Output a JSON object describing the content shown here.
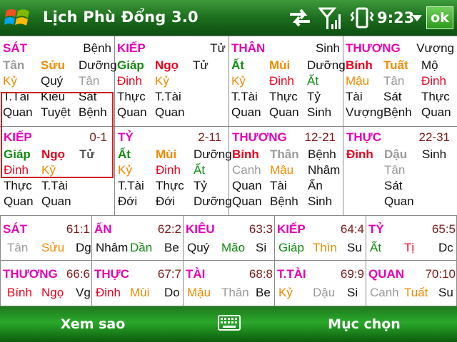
{
  "title_bar": {
    "app_title": "Lịch Phù Đổng 3.0",
    "clock": "9:23",
    "ok_label": "ok"
  },
  "top_blocks": [
    {
      "head": "SÁT",
      "head_color": "mag",
      "right": "Bệnh",
      "rows": [
        [
          [
            "Tân",
            "gry"
          ],
          [
            "Sửu",
            "org"
          ],
          [
            "Dưỡng",
            "blk"
          ]
        ],
        [
          [
            "Kỷ",
            "org"
          ],
          [
            "Quý",
            "blk"
          ],
          [
            "Tân",
            "gry"
          ]
        ],
        [
          [
            "T.Tài",
            "blk"
          ],
          [
            "Kiêu",
            "blk"
          ],
          [
            "Sát",
            "blk"
          ]
        ],
        [
          [
            "Quan",
            "blk"
          ],
          [
            "Tuyệt",
            "blk"
          ],
          [
            "Bệnh",
            "blk"
          ]
        ]
      ]
    },
    {
      "head": "KIẾP",
      "head_color": "mag",
      "right": "Tử",
      "rows": [
        [
          [
            "Giáp",
            "grn"
          ],
          [
            "Ngọ",
            "red"
          ],
          [
            "Tử",
            "blk"
          ]
        ],
        [
          [
            "Đinh",
            "red"
          ],
          [
            "Kỷ",
            "org"
          ],
          [
            "",
            ""
          ]
        ],
        [
          [
            "Thực",
            "blk"
          ],
          [
            "T.Tài",
            "blk"
          ],
          [
            "",
            ""
          ]
        ],
        [
          [
            "Quan",
            "blk"
          ],
          [
            "Quan",
            "blk"
          ],
          [
            "",
            ""
          ]
        ]
      ]
    },
    {
      "head": "THÂN",
      "head_color": "mag",
      "right": "Sinh",
      "rows": [
        [
          [
            "Ất",
            "grn"
          ],
          [
            "Mùi",
            "org"
          ],
          [
            "Dưỡng",
            "blk"
          ]
        ],
        [
          [
            "Kỷ",
            "org"
          ],
          [
            "Đinh",
            "red"
          ],
          [
            "Ất",
            "grn"
          ]
        ],
        [
          [
            "T.Tài",
            "blk"
          ],
          [
            "Thực",
            "blk"
          ],
          [
            "Tỷ",
            "blk"
          ]
        ],
        [
          [
            "Quan",
            "blk"
          ],
          [
            "Quan",
            "blk"
          ],
          [
            "Sinh",
            "blk"
          ]
        ]
      ]
    },
    {
      "head": "THƯƠNG",
      "head_color": "mag",
      "right": "Vượng",
      "rows": [
        [
          [
            "Bính",
            "red"
          ],
          [
            "Tuất",
            "org"
          ],
          [
            "Mộ",
            "blk"
          ]
        ],
        [
          [
            "Mậu",
            "org"
          ],
          [
            "Tân",
            "gry"
          ],
          [
            "Đinh",
            "red"
          ]
        ],
        [
          [
            "Tài",
            "blk"
          ],
          [
            "Sát",
            "blk"
          ],
          [
            "Thực",
            "blk"
          ]
        ],
        [
          [
            "Vượng",
            "blk"
          ],
          [
            "Bệnh",
            "blk"
          ],
          [
            "Quan",
            "blk"
          ]
        ]
      ]
    }
  ],
  "mid_blocks": [
    {
      "head": "KIẾP",
      "head_color": "mag",
      "range": "0-1",
      "rows": [
        [
          [
            "Giáp",
            "grn"
          ],
          [
            "Ngọ",
            "red"
          ],
          [
            "Tử",
            "blk"
          ]
        ],
        [
          [
            "Đinh",
            "red"
          ],
          [
            "Kỷ",
            "org"
          ],
          [
            "",
            ""
          ]
        ],
        [
          [
            "Thực",
            "blk"
          ],
          [
            "T.Tài",
            "blk"
          ],
          [
            "",
            ""
          ]
        ],
        [
          [
            "Quan",
            "blk"
          ],
          [
            "Quan",
            "blk"
          ],
          [
            "",
            ""
          ]
        ]
      ]
    },
    {
      "head": "TỶ",
      "head_color": "mag",
      "range": "2-11",
      "rows": [
        [
          [
            "Ất",
            "grn"
          ],
          [
            "Mùi",
            "org"
          ],
          [
            "Dưỡng",
            "blk"
          ]
        ],
        [
          [
            "Kỷ",
            "org"
          ],
          [
            "Đinh",
            "red"
          ],
          [
            "Ất",
            "grn"
          ]
        ],
        [
          [
            "T.Tài",
            "blk"
          ],
          [
            "Thực",
            "blk"
          ],
          [
            "Tỷ",
            "blk"
          ]
        ],
        [
          [
            "Đới",
            "blk"
          ],
          [
            "Đới",
            "blk"
          ],
          [
            "Dưỡng",
            "blk"
          ]
        ]
      ]
    },
    {
      "head": "THƯƠNG",
      "head_color": "mag",
      "range": "12-21",
      "rows": [
        [
          [
            "Bính",
            "red"
          ],
          [
            "Thân",
            "gry"
          ],
          [
            "Bệnh",
            "blk"
          ]
        ],
        [
          [
            "Canh",
            "gry"
          ],
          [
            "Mậu",
            "org"
          ],
          [
            "Nhâm",
            "blk"
          ]
        ],
        [
          [
            "Quan",
            "blk"
          ],
          [
            "Tài",
            "blk"
          ],
          [
            "Ấn",
            "blk"
          ]
        ],
        [
          [
            "Quan",
            "blk"
          ],
          [
            "Bệnh",
            "blk"
          ],
          [
            "Sinh",
            "blk"
          ]
        ]
      ]
    },
    {
      "head": "THỰC",
      "head_color": "mag",
      "range": "22-31",
      "rows": [
        [
          [
            "Đinh",
            "red"
          ],
          [
            "Dậu",
            "gry"
          ],
          [
            "Sinh",
            "blk"
          ]
        ],
        [
          [
            "",
            ""
          ],
          [
            "Tân",
            "gry"
          ],
          [
            "",
            ""
          ]
        ],
        [
          [
            "",
            ""
          ],
          [
            "Sát",
            "blk"
          ],
          [
            "",
            ""
          ]
        ],
        [
          [
            "",
            ""
          ],
          [
            "Quan",
            "blk"
          ],
          [
            "",
            ""
          ]
        ]
      ]
    }
  ],
  "bottom_rows": [
    [
      {
        "head": "SÁT",
        "range": "61:1",
        "items": [
          [
            "Tân",
            "gry"
          ],
          [
            "Sửu",
            "org"
          ],
          [
            "Dg",
            "blk"
          ]
        ]
      },
      {
        "head": "ẤN",
        "range": "62:2",
        "items": [
          [
            "Nhâm",
            "blk"
          ],
          [
            "Dần",
            "grn"
          ],
          [
            "Be",
            "blk"
          ]
        ]
      },
      {
        "head": "KIÊU",
        "range": "63:3",
        "items": [
          [
            "Quý",
            "blk"
          ],
          [
            "Mão",
            "grn"
          ],
          [
            "Si",
            "blk"
          ]
        ]
      },
      {
        "head": "KIẾP",
        "range": "64:4",
        "items": [
          [
            "Giáp",
            "grn"
          ],
          [
            "Thìn",
            "org"
          ],
          [
            "Su",
            "blk"
          ]
        ]
      },
      {
        "head": "TỶ",
        "range": "65:5",
        "items": [
          [
            "Ất",
            "grn"
          ],
          [
            "Tị",
            "red"
          ],
          [
            "Dc",
            "blk"
          ]
        ]
      }
    ],
    [
      {
        "head": "THƯƠNG",
        "range": "66:6",
        "items": [
          [
            "Bính",
            "red"
          ],
          [
            "Ngọ",
            "red"
          ],
          [
            "Vg",
            "blk"
          ]
        ]
      },
      {
        "head": "THỰC",
        "range": "67:7",
        "items": [
          [
            "Đinh",
            "red"
          ],
          [
            "Mùi",
            "org"
          ],
          [
            "Do",
            "blk"
          ]
        ]
      },
      {
        "head": "TÀI",
        "range": "68:8",
        "items": [
          [
            "Mậu",
            "org"
          ],
          [
            "Thân",
            "gry"
          ],
          [
            "Be",
            "blk"
          ]
        ]
      },
      {
        "head": "T.TÀI",
        "range": "69:9",
        "items": [
          [
            "Kỷ",
            "org"
          ],
          [
            "Dậu",
            "gry"
          ],
          [
            "Si",
            "blk"
          ]
        ]
      },
      {
        "head": "QUAN",
        "range": "70:10",
        "items": [
          [
            "Canh",
            "gry"
          ],
          [
            "Tuất",
            "org"
          ],
          [
            "Su",
            "blk"
          ]
        ]
      }
    ]
  ],
  "menu_bar": {
    "left_softkey": "Xem sao",
    "right_softkey": "Mục chọn"
  },
  "icons": [
    "windows-start-icon",
    "sync-icon",
    "signal-icon",
    "vibrate-icon",
    "keyboard-icon"
  ]
}
